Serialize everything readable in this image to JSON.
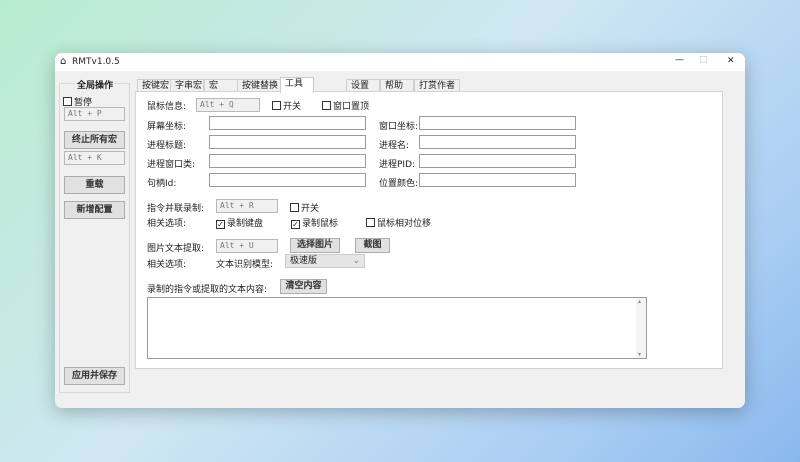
{
  "window": {
    "title": "RMTv1.0.5",
    "minimize": "—",
    "maximize": "□",
    "close": "✕"
  },
  "sidebar": {
    "group_title": "全局操作",
    "pause_label": "暂停",
    "pause_checked": false,
    "pause_hotkey": "Alt + P",
    "stop_all": "终止所有宏",
    "stop_hotkey": "Alt + K",
    "reload": "重载",
    "add_config": "新增配置",
    "apply_save": "应用并保存"
  },
  "tabs": [
    {
      "label": "按键宏"
    },
    {
      "label": "字串宏"
    },
    {
      "label": "宏"
    },
    {
      "label": "按键替换"
    },
    {
      "label": "工具",
      "selected": true
    },
    {
      "label": "设置"
    },
    {
      "label": "帮助"
    },
    {
      "label": "打赏作者"
    }
  ],
  "tools": {
    "mouse_info_label": "鼠标信息:",
    "mouse_info_hotkey": "Alt + Q",
    "switch_label": "开关",
    "topmost_label": "窗口置顶",
    "screen_coord": "屏幕坐标:",
    "window_coord": "窗口坐标:",
    "proc_title": "进程标题:",
    "proc_name": "进程名:",
    "proc_class": "进程窗口类:",
    "proc_pid": "进程PID:",
    "handle_id": "句柄Id:",
    "pos_color": "位置颜色:",
    "record_label": "指令并联录制:",
    "record_hotkey": "Alt + R",
    "record_switch": "开关",
    "options_label": "相关选项:",
    "rec_keyboard": "录制键盘",
    "rec_mouse": "录制鼠标",
    "rel_move": "鼠标相对位移",
    "ocr_label": "图片文本提取:",
    "ocr_hotkey": "Alt + U",
    "choose_image": "选择图片",
    "screenshot": "截图",
    "options_label2": "相关选项:",
    "ocr_model_label": "文本识别模型:",
    "ocr_model_value": "极速版",
    "output_label": "录制的指令或提取的文本内容:",
    "clear": "清空内容",
    "output_text": ""
  }
}
